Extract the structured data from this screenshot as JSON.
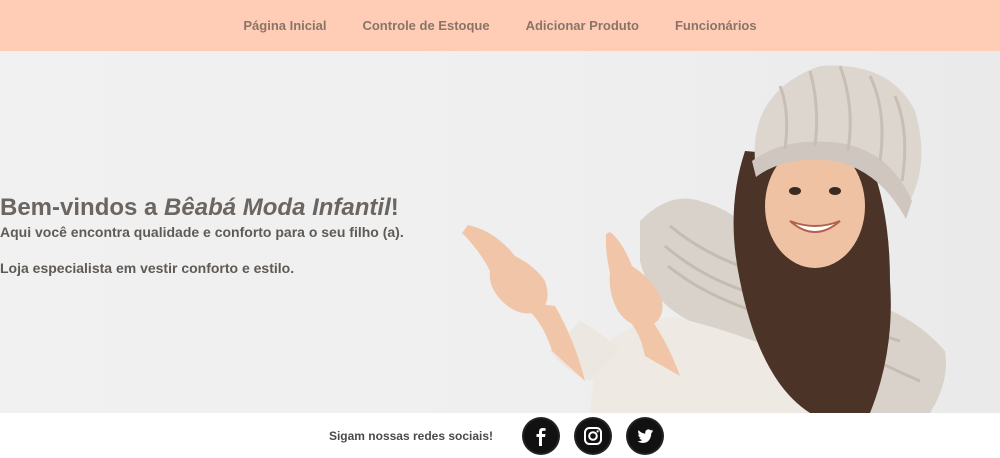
{
  "nav": {
    "items": [
      {
        "label": "Página Inicial"
      },
      {
        "label": "Controle de Estoque"
      },
      {
        "label": "Adicionar Produto"
      },
      {
        "label": "Funcionários"
      }
    ]
  },
  "hero": {
    "title_prefix": "Bem-vindos a ",
    "title_brand": "Bêabá Moda Infantil",
    "title_suffix": "!",
    "line1": "Aqui você encontra qualidade e conforto para o seu filho (a).",
    "line2": "Loja especialista em vestir conforto e estilo."
  },
  "footer": {
    "text": "Sigam nossas redes sociais!",
    "icons": [
      "facebook-icon",
      "instagram-icon",
      "twitter-icon"
    ]
  },
  "colors": {
    "nav_bg": "#ffcdb5",
    "nav_text": "#8a7468",
    "hero_text": "#6b6661"
  }
}
